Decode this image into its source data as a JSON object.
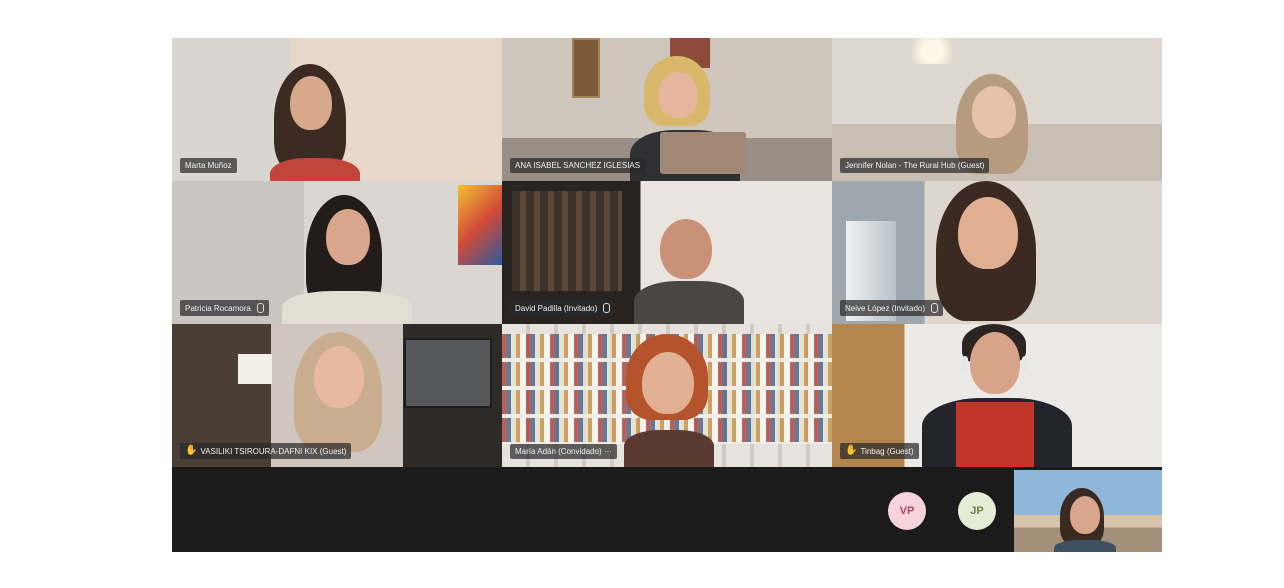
{
  "participants": [
    {
      "name": "Marta Muñoz",
      "hand_raised": false,
      "muted": false
    },
    {
      "name": "ANA ISABEL SANCHEZ IGLESIAS",
      "hand_raised": false,
      "muted": false
    },
    {
      "name": "Jennifer Nolan - The Rural Hub (Guest)",
      "hand_raised": false,
      "muted": false
    },
    {
      "name": "Patricia Rocamora",
      "hand_raised": false,
      "muted": true
    },
    {
      "name": "David Padilla (Invitado)",
      "hand_raised": false,
      "muted": true
    },
    {
      "name": "Neive López (Invitado)",
      "hand_raised": false,
      "muted": true
    },
    {
      "name": "VASILIKI TSIROURA-DAFNI KIX (Guest)",
      "hand_raised": true,
      "muted": false
    },
    {
      "name": "María Adán (Convidado) ···",
      "hand_raised": false,
      "muted": false
    },
    {
      "name": "Tinbag (Guest)",
      "hand_raised": true,
      "muted": false
    }
  ],
  "avatars": [
    {
      "initials": "VP",
      "bg": "#f6d3dc",
      "fg": "#b0475f"
    },
    {
      "initials": "JP",
      "bg": "#e4ecd6",
      "fg": "#6c7f4a"
    }
  ],
  "colors": {
    "stage": "#1b1b1b",
    "name_tag": "#282828"
  }
}
